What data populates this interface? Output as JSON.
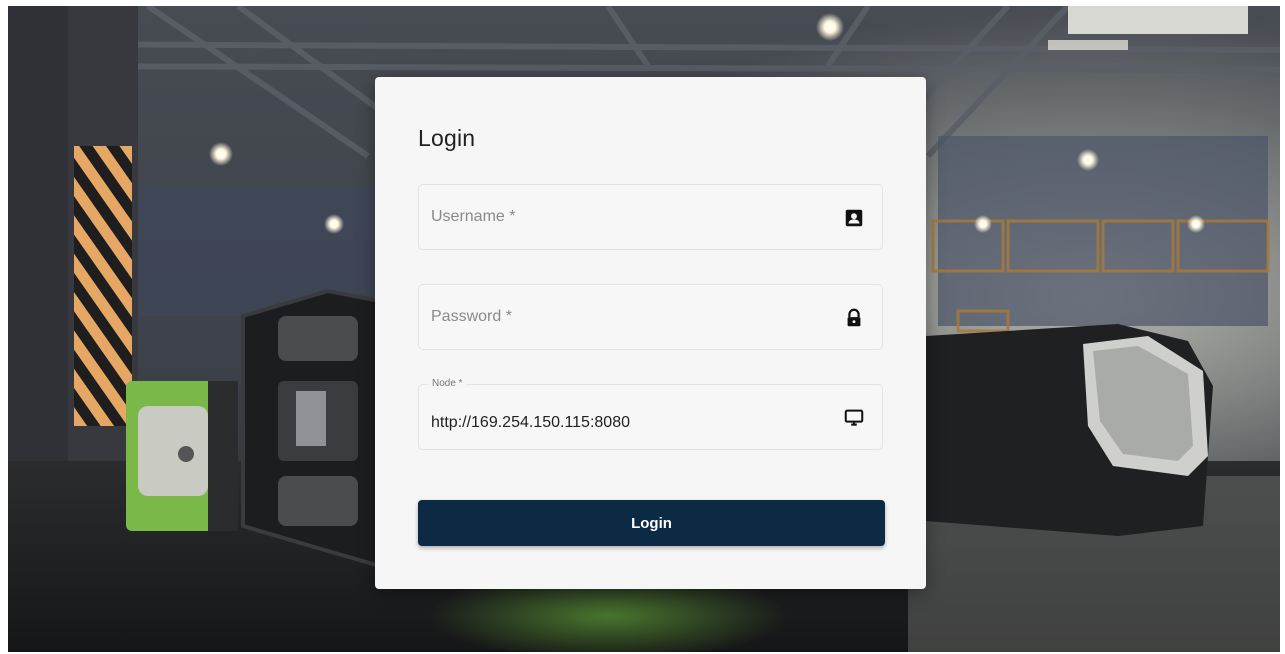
{
  "login": {
    "title": "Login",
    "username": {
      "placeholder": "Username *",
      "value": "",
      "icon": "user-card-icon"
    },
    "password": {
      "placeholder": "Password *",
      "value": "",
      "icon": "lock-icon"
    },
    "node": {
      "label": "Node *",
      "value": "http://169.254.150.115:8080",
      "icon": "monitor-icon"
    },
    "submit_label": "Login"
  },
  "colors": {
    "button": "#0d2a45",
    "card": "#f6f6f6"
  },
  "background": {
    "description_icon": "warehouse-product-scene"
  }
}
